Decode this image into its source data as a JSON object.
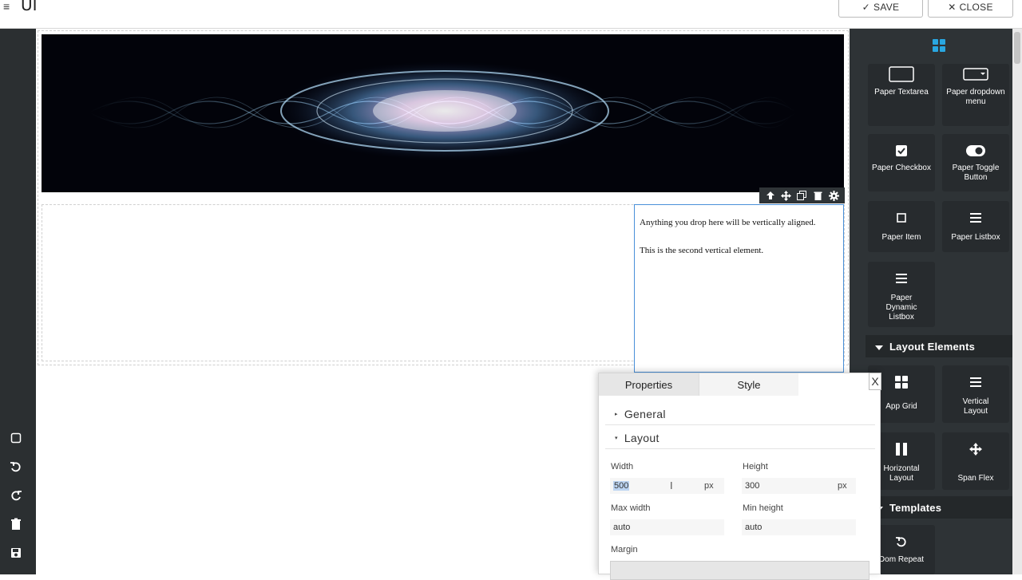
{
  "header": {
    "menu_icon": "hamburger-icon",
    "title": "UI",
    "save_label": "SAVE",
    "close_label": "CLOSE"
  },
  "left_rail": {
    "icons": [
      "square-icon",
      "undo-icon",
      "redo-icon",
      "trash-icon",
      "save-disk-icon"
    ]
  },
  "canvas": {
    "vertical_layout": {
      "line1": "Anything you drop here will be vertically aligned.",
      "line2": "This is the second vertical element."
    },
    "element_toolbar_icons": [
      "arrow-up-icon",
      "move-icon",
      "copy-icon",
      "trash-icon",
      "gear-icon"
    ]
  },
  "properties_panel": {
    "tabs": [
      "Properties",
      "Style"
    ],
    "close_label": "X",
    "sections": {
      "general": "General",
      "layout": "Layout"
    },
    "fields": {
      "width_label": "Width",
      "width_value": "500",
      "width_unit": "px",
      "height_label": "Height",
      "height_value": "300",
      "height_unit": "px",
      "max_width_label": "Max width",
      "max_width_value": "auto",
      "min_height_label": "Min height",
      "min_height_value": "auto",
      "margin_label": "Margin"
    }
  },
  "palette": {
    "top_icon": "grid-icon",
    "items": [
      {
        "label": "Paper Textarea",
        "icon": "textarea-icon"
      },
      {
        "label": "Paper dropdown menu",
        "icon": "dropdown-icon"
      },
      {
        "label": "Paper Checkbox",
        "icon": "checkbox-icon"
      },
      {
        "label": "Paper Toggle Button",
        "icon": "toggle-icon"
      },
      {
        "label": "Paper Item",
        "icon": "square-icon"
      },
      {
        "label": "Paper Listbox",
        "icon": "list-icon"
      },
      {
        "label": "Paper Dynamic Listbox",
        "icon": "list-icon"
      }
    ],
    "layout_section": "Layout Elements",
    "layout_items": [
      {
        "label": "App Grid",
        "icon": "grid-icon"
      },
      {
        "label": "Vertical Layout",
        "icon": "list-icon"
      },
      {
        "label": "Horizontal Layout",
        "icon": "columns-icon"
      },
      {
        "label": "Span Flex",
        "icon": "move-icon"
      }
    ],
    "templates_section": "Templates",
    "template_items": [
      {
        "label": "Dom Repeat",
        "icon": "repeat-icon"
      }
    ]
  },
  "colors": {
    "rail": "#2b2f31",
    "panel": "#2e3336",
    "accent": "#4a90d9",
    "grid_icon": "#29a7e1"
  }
}
